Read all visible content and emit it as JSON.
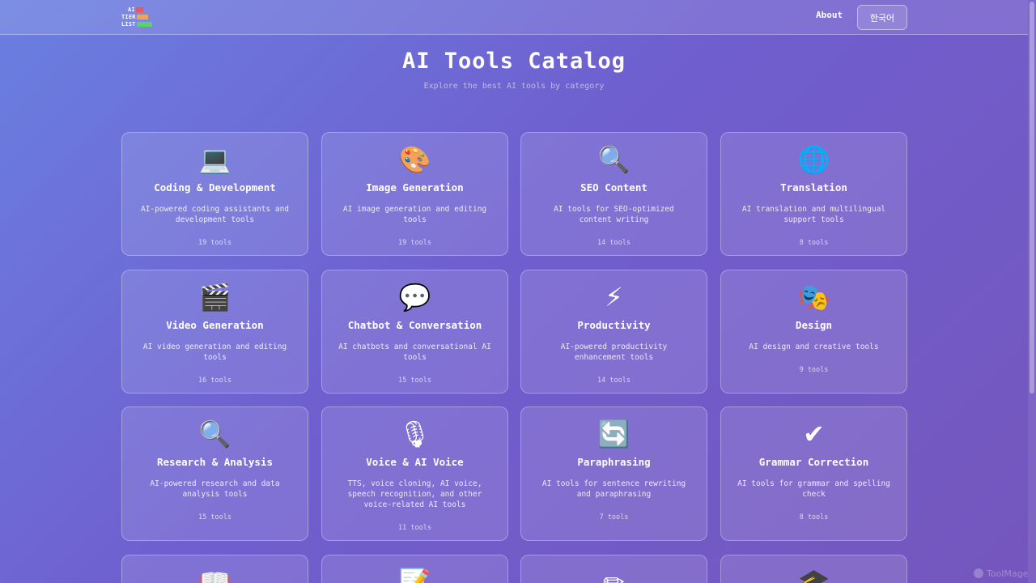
{
  "header": {
    "logo": {
      "rows": [
        {
          "text": "AI",
          "color": "#e85a5a",
          "bar_len": 9
        },
        {
          "text": "TIER",
          "color": "#f0a35a",
          "bar_len": 14
        },
        {
          "text": "LIST",
          "color": "#5ad26a",
          "bar_len": 19
        }
      ]
    },
    "nav": {
      "about_label": "About",
      "language_label": "한국어"
    }
  },
  "hero": {
    "title": "AI Tools Catalog",
    "subtitle": "Explore the best AI tools by category"
  },
  "categories": [
    {
      "icon": "💻",
      "icon_name": "laptop-icon",
      "title": "Coding & Development",
      "description": "AI-powered coding assistants and development tools",
      "count": "19 tools"
    },
    {
      "icon": "🎨",
      "icon_name": "palette-icon",
      "title": "Image Generation",
      "description": "AI image generation and editing tools",
      "count": "19 tools"
    },
    {
      "icon": "🔍",
      "icon_name": "magnifier-icon",
      "title": "SEO Content",
      "description": "AI tools for SEO-optimized content writing",
      "count": "14 tools"
    },
    {
      "icon": "🌐",
      "icon_name": "globe-icon",
      "title": "Translation",
      "description": "AI translation and multilingual support tools",
      "count": "8 tools"
    },
    {
      "icon": "🎬",
      "icon_name": "clapperboard-icon",
      "title": "Video Generation",
      "description": "AI video generation and editing tools",
      "count": "16 tools"
    },
    {
      "icon": "💬",
      "icon_name": "speech-bubble-icon",
      "title": "Chatbot & Conversation",
      "description": "AI chatbots and conversational AI tools",
      "count": "15 tools"
    },
    {
      "icon": "⚡",
      "icon_name": "lightning-icon",
      "title": "Productivity",
      "description": "AI-powered productivity enhancement tools",
      "count": "14 tools"
    },
    {
      "icon": "🎭",
      "icon_name": "theater-masks-icon",
      "title": "Design",
      "description": "AI design and creative tools",
      "count": "9 tools"
    },
    {
      "icon": "🔍",
      "icon_name": "magnifier-icon",
      "title": "Research & Analysis",
      "description": "AI-powered research and data analysis tools",
      "count": "15 tools"
    },
    {
      "icon": "🎙",
      "icon_name": "microphone-icon",
      "title": "Voice & AI Voice",
      "description": "TTS, voice cloning, AI voice, speech recognition, and other voice-related AI tools",
      "count": "11 tools"
    },
    {
      "icon": "🔄",
      "icon_name": "refresh-icon",
      "title": "Paraphrasing",
      "description": "AI tools for sentence rewriting and paraphrasing",
      "count": "7 tools"
    },
    {
      "icon": "✔",
      "icon_name": "check-mark-icon",
      "title": "Grammar Correction",
      "description": "AI tools for grammar and spelling check",
      "count": "8 tools"
    },
    {
      "icon": "📖",
      "icon_name": "open-book-icon",
      "title": "",
      "description": "",
      "count": ""
    },
    {
      "icon": "📝",
      "icon_name": "memo-icon",
      "title": "",
      "description": "",
      "count": ""
    },
    {
      "icon": "✏",
      "icon_name": "pencil-icon",
      "title": "",
      "description": "",
      "count": ""
    },
    {
      "icon": "🎓",
      "icon_name": "graduation-cap-icon",
      "title": "",
      "description": "",
      "count": ""
    }
  ],
  "watermark": {
    "text": "ToolMage"
  }
}
